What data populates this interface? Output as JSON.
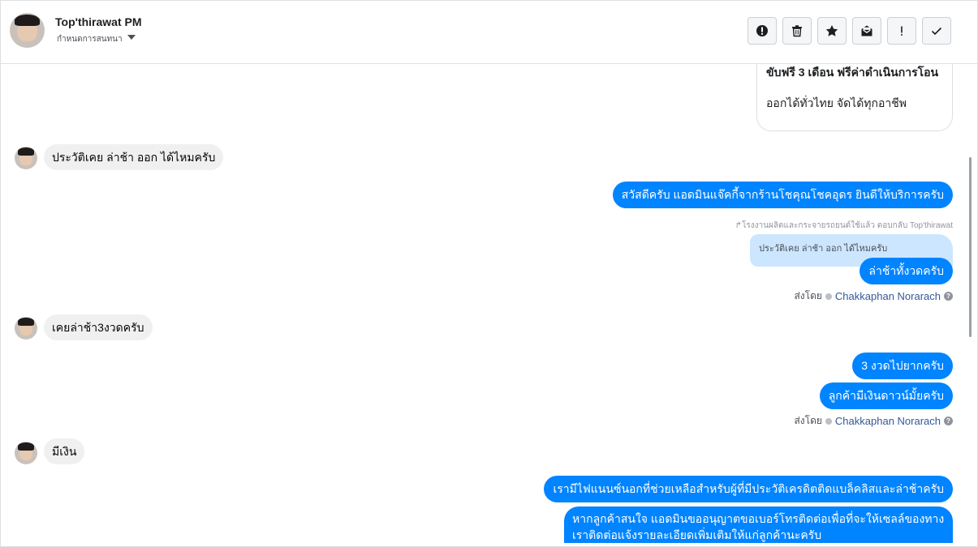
{
  "header": {
    "name": "Top'thirawat PM",
    "subtitle": "กำหนดการสนทนา"
  },
  "toolbar": [
    {
      "name": "mark-spam-button",
      "icon": "exclamation-circle-icon"
    },
    {
      "name": "delete-button",
      "icon": "trash-icon"
    },
    {
      "name": "star-button",
      "icon": "star-icon"
    },
    {
      "name": "mark-unread-button",
      "icon": "mail-icon"
    },
    {
      "name": "follow-up-button",
      "icon": "exclamation-icon"
    },
    {
      "name": "mark-done-button",
      "icon": "check-icon"
    }
  ],
  "card": {
    "title": "ขับฟรี 3 เดือน ฟรีค่าดำเนินการโอน",
    "subtitle": "ออกได้ทั่วไทย จัดได้ทุกอาชีพ"
  },
  "messages": {
    "in_1": "ประวัติเคย ล่าช้า ออก ได้ไหมครับ",
    "out_1": "สวัสดีครับ แอดมินแจ๊คกี้จากร้านโชคุณโชคอุดร ยินดีให้บริการครับ",
    "reply_note": "โรงงานผลิตและกระจายรถยนต์ใช้แล้ว ตอบกลับ Top'thirawat",
    "quoted": "ประวัติเคย ล่าช้า ออก ได้ไหมครับ",
    "out_2": "ล่าช้าทั้งวดครับ",
    "in_2": "เคยล่าช้า3งวดครับ",
    "out_3": "3 งวดไปยากครับ",
    "out_4": "ลูกค้ามีเงินดาวน์มั้ยครับ",
    "in_3": "มีเงิน",
    "out_5": "เรามีไฟแนนซ์นอกที่ช่วยเหลือสำหรับผู้ที่มีประวัติเครดิตติดแบล็คลิสและล่าช้าครับ",
    "out_6": "หากลูกค้าสนใจ แอดมินขออนุญาตขอเบอร์โทรติดต่อเพื่อที่จะให้เซลล์ของทางเราติดต่อแจ้งรายละเอียดเพิ่มเติมให้แก่ลูกค้านะครับ"
  },
  "sent_by": {
    "label": "ส่งโดย",
    "name": "Chakkaphan Norarach",
    "help": "?"
  }
}
